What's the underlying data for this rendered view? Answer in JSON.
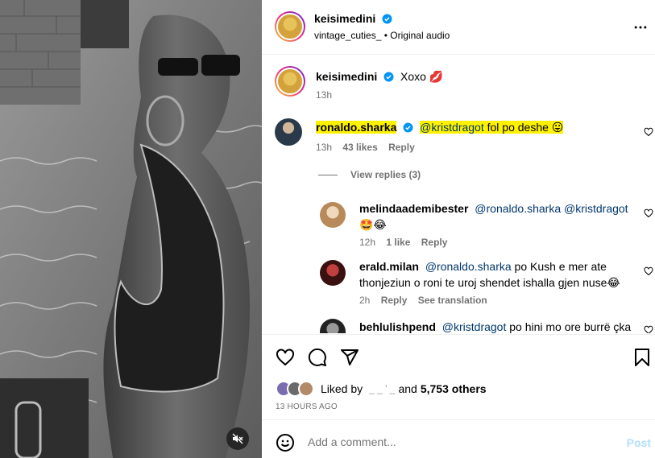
{
  "post": {
    "author": "keisimedini",
    "audio_user": "vintage_cuties_",
    "audio_label": "Original audio",
    "more_icon": "more-horizontal-icon"
  },
  "caption": {
    "author": "keisimedini",
    "text": "Xoxo 💋",
    "time": "13h"
  },
  "comments": [
    {
      "author": "ronaldo.sharka",
      "mention": "@kristdragot",
      "text": " fol po deshe 😛",
      "time": "13h",
      "likes": "43 likes",
      "reply": "Reply",
      "view_replies": "View replies (3)"
    }
  ],
  "replies": [
    {
      "author": "melindaademibester",
      "text": "@ronaldo.sharka @kristdragot",
      "text2": "🤩😂",
      "time": "12h",
      "likes": "1 like",
      "reply": "Reply"
    },
    {
      "author": "erald.milan",
      "mention": "@ronaldo.sharka",
      "text": " po Kush e mer ate",
      "text2": "thonjeziun o roni te uroj shendet ishalla gjen nuse😂",
      "time": "2h",
      "reply": "Reply",
      "translation": "See translation"
    },
    {
      "author": "behlulishpend",
      "mention": "@kristdragot",
      "text": " po hini mo ore burrë çka"
    }
  ],
  "likes": {
    "prefix": "Liked by",
    "hidden_user": "_ _ ' _",
    "and": "and",
    "count": "5,753 others",
    "date": "13 HOURS AGO"
  },
  "add_comment": {
    "placeholder": "Add a comment...",
    "post": "Post"
  },
  "colors": {
    "highlight": "#fff200",
    "verified": "#0095f6",
    "mention": "#00376b",
    "post_disabled": "#b2dffc"
  }
}
